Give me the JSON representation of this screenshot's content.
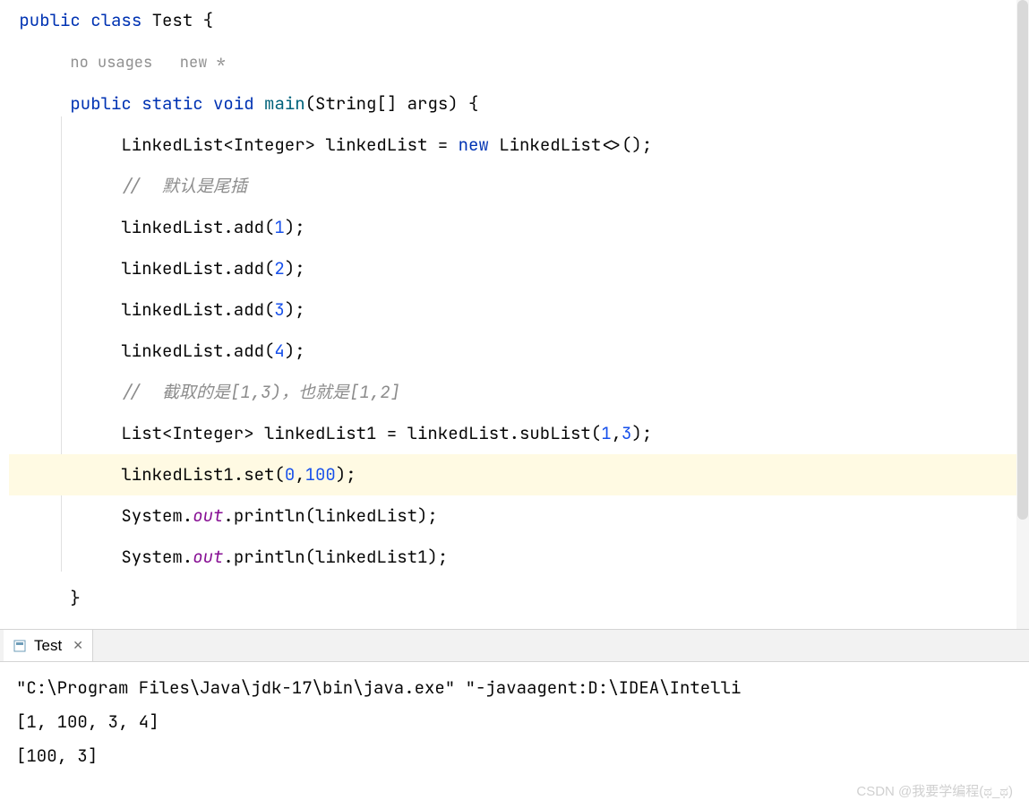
{
  "code": {
    "lines": [
      {
        "indent": 0,
        "tokens": [
          {
            "t": "public ",
            "c": "keyword"
          },
          {
            "t": "class ",
            "c": "keyword"
          },
          {
            "t": "Test ",
            "c": ""
          },
          {
            "t": "{",
            "c": ""
          }
        ]
      },
      {
        "indent": 1,
        "tokens": [
          {
            "t": "no usages   new *",
            "c": "annotation"
          }
        ]
      },
      {
        "indent": 1,
        "tokens": [
          {
            "t": "public ",
            "c": "keyword"
          },
          {
            "t": "static ",
            "c": "keyword"
          },
          {
            "t": "void ",
            "c": "keyword"
          },
          {
            "t": "main",
            "c": "method-name"
          },
          {
            "t": "(String[] args) {",
            "c": ""
          }
        ]
      },
      {
        "indent": 2,
        "tokens": [
          {
            "t": "LinkedList<Integer> linkedList = ",
            "c": ""
          },
          {
            "t": "new ",
            "c": "keyword"
          },
          {
            "t": "LinkedList<>();",
            "c": ""
          }
        ]
      },
      {
        "indent": 2,
        "tokens": [
          {
            "t": "//  默认是尾插",
            "c": "comment"
          }
        ]
      },
      {
        "indent": 2,
        "tokens": [
          {
            "t": "linkedList.add(",
            "c": ""
          },
          {
            "t": "1",
            "c": "number"
          },
          {
            "t": ");",
            "c": ""
          }
        ]
      },
      {
        "indent": 2,
        "tokens": [
          {
            "t": "linkedList.add(",
            "c": ""
          },
          {
            "t": "2",
            "c": "number"
          },
          {
            "t": ");",
            "c": ""
          }
        ]
      },
      {
        "indent": 2,
        "tokens": [
          {
            "t": "linkedList.add(",
            "c": ""
          },
          {
            "t": "3",
            "c": "number"
          },
          {
            "t": ");",
            "c": ""
          }
        ]
      },
      {
        "indent": 2,
        "tokens": [
          {
            "t": "linkedList.add(",
            "c": ""
          },
          {
            "t": "4",
            "c": "number"
          },
          {
            "t": ");",
            "c": ""
          }
        ]
      },
      {
        "indent": 2,
        "tokens": [
          {
            "t": "//  截取的是[1,3)，也就是[1,2]",
            "c": "comment"
          }
        ]
      },
      {
        "indent": 2,
        "tokens": [
          {
            "t": "List<Integer> linkedList1 = linkedList.subList(",
            "c": ""
          },
          {
            "t": "1",
            "c": "number"
          },
          {
            "t": ",",
            "c": ""
          },
          {
            "t": "3",
            "c": "number"
          },
          {
            "t": ");",
            "c": ""
          }
        ]
      },
      {
        "indent": 2,
        "highlighted": true,
        "tokens": [
          {
            "t": "linkedList1.set(",
            "c": ""
          },
          {
            "t": "0",
            "c": "number"
          },
          {
            "t": ",",
            "c": ""
          },
          {
            "t": "100",
            "c": "number"
          },
          {
            "t": ");",
            "c": ""
          }
        ]
      },
      {
        "indent": 2,
        "tokens": [
          {
            "t": "System.",
            "c": ""
          },
          {
            "t": "out",
            "c": "static-field"
          },
          {
            "t": ".println(linkedList);",
            "c": ""
          }
        ]
      },
      {
        "indent": 2,
        "tokens": [
          {
            "t": "System.",
            "c": ""
          },
          {
            "t": "out",
            "c": "static-field"
          },
          {
            "t": ".println(linkedList1);",
            "c": ""
          }
        ]
      },
      {
        "indent": 1,
        "tokens": [
          {
            "t": "}",
            "c": ""
          }
        ]
      },
      {
        "indent": 0,
        "tokens": [
          {
            "t": "}",
            "c": ""
          }
        ]
      }
    ]
  },
  "console": {
    "tab_label": "Test",
    "output_lines": [
      "\"C:\\Program Files\\Java\\jdk-17\\bin\\java.exe\" \"-javaagent:D:\\IDEA\\Intelli",
      "[1, 100, 3, 4]",
      "[100, 3]"
    ]
  },
  "watermark": "CSDN @我要学编程(ಥ_ಥ)"
}
